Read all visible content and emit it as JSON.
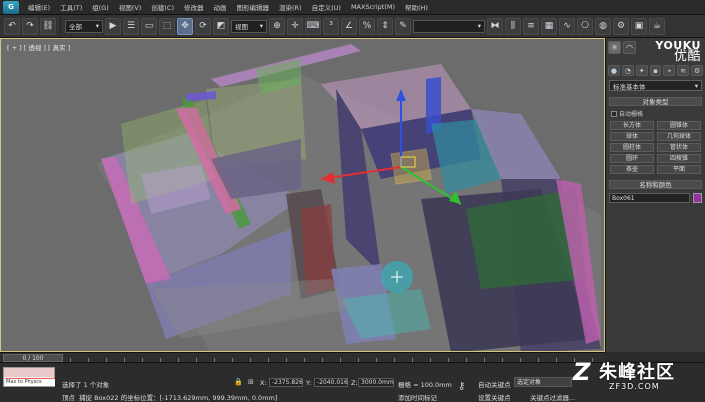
{
  "menubar": {
    "items": [
      "编辑(E)",
      "工具(T)",
      "组(G)",
      "视图(V)",
      "创建(C)",
      "修改器",
      "动画",
      "图形编辑器",
      "渲染(R)",
      "自定义(U)",
      "MAXScript(M)",
      "帮助(H)"
    ]
  },
  "toolbar": {
    "selection_filter": "全部",
    "ref_coord": "视图",
    "named_selection": ""
  },
  "viewport": {
    "label": "[ + ] [ 透视 ] [ 真实 ]"
  },
  "watermark": {
    "youku": "YOUKU",
    "youku_cn": "优酷",
    "zf_cn": "朱峰社区",
    "zf_url": "ZF3D.COM"
  },
  "command_panel": {
    "geometry_type": "标准基本体",
    "object_type_title": "对象类型",
    "autogrid": "自动栅格",
    "objects": [
      "长方体",
      "圆锥体",
      "球体",
      "几何球体",
      "圆柱体",
      "管状体",
      "圆环",
      "四棱锥",
      "茶壶",
      "平面"
    ],
    "name_color_title": "名称和颜色",
    "object_name": "Box061",
    "object_color": "#9a2fa8"
  },
  "timeline": {
    "frame": "0 / 100"
  },
  "statusbar": {
    "maxscript": "Max to Physcs",
    "selected": "选择了 1 个对象",
    "prompt": "捕捉 Box022 的坐标位置：[-1713.629mm, 999.39mm, 0.0mm]",
    "prompt_prefix": "顶点",
    "x_label": "X:",
    "x_value": "-2375.826",
    "y_label": "Y:",
    "y_value": "-2040.016",
    "z_label": "Z:",
    "z_value": "3000.0mm",
    "grid": "栅格 = 100.0mm",
    "add_time_tag": "添加时间标记",
    "autokey": "自动关键点",
    "set_key": "设置关键点",
    "selected_obj": "选定对象",
    "key_filters": "关键点过滤器..."
  }
}
